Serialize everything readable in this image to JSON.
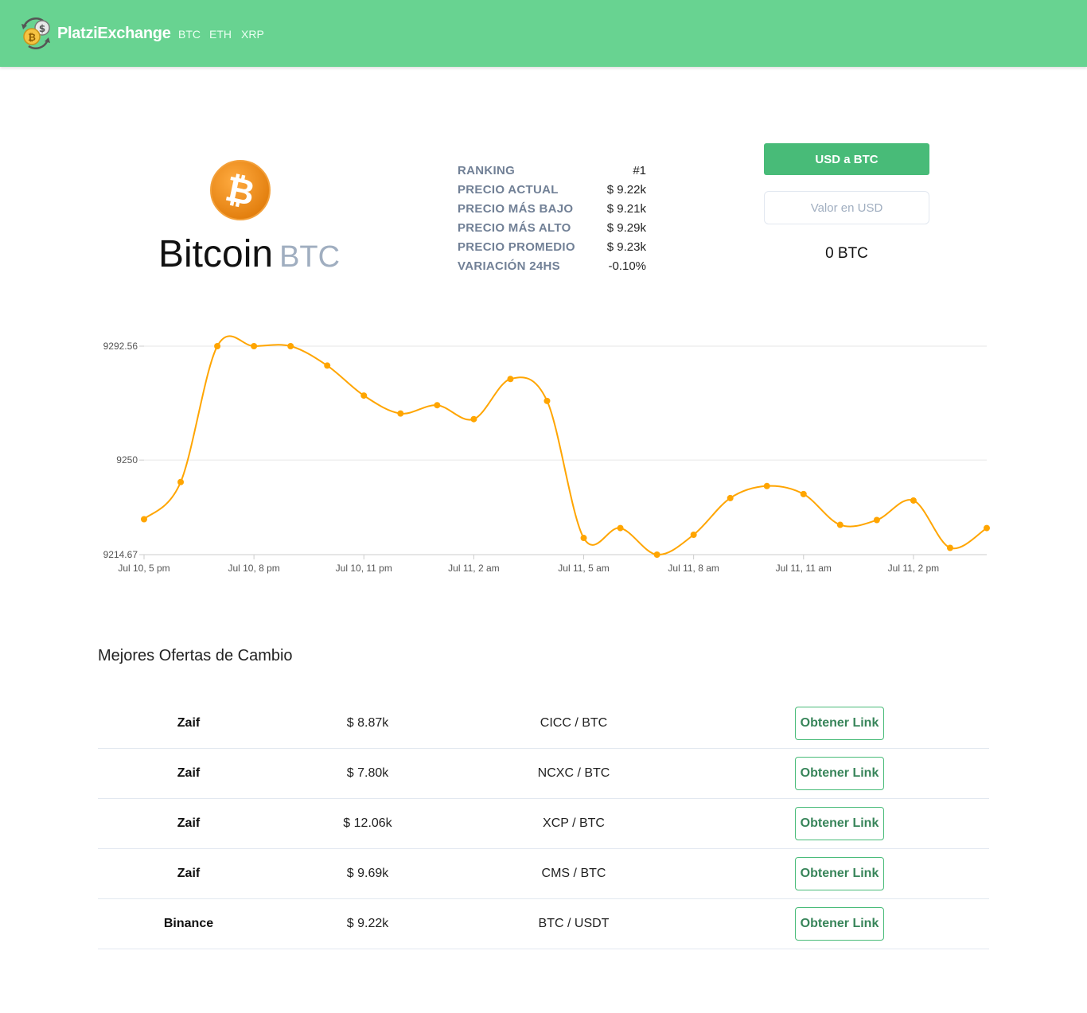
{
  "header": {
    "brand": "PlatziExchange",
    "nav": [
      "BTC",
      "ETH",
      "XRP"
    ],
    "bg_color": "#68d391"
  },
  "coin": {
    "name": "Bitcoin",
    "symbol": "BTC",
    "icon": "bitcoin-icon",
    "icon_color": "#f7931a"
  },
  "stats": [
    {
      "label": "RANKING",
      "value": "#1"
    },
    {
      "label": "PRECIO ACTUAL",
      "value": "$ 9.22k"
    },
    {
      "label": "PRECIO MÁS BAJO",
      "value": "$ 9.21k"
    },
    {
      "label": "PRECIO MÁS ALTO",
      "value": "$ 9.29k"
    },
    {
      "label": "PRECIO PROMEDIO",
      "value": "$ 9.23k"
    },
    {
      "label": "VARIACIÓN 24HS",
      "value": "-0.10%"
    }
  ],
  "converter": {
    "button_label": "USD a BTC",
    "input_placeholder": "Valor en USD",
    "input_value": "",
    "result": "0 BTC",
    "accent": "#48bb78"
  },
  "chart_data": {
    "type": "line",
    "title": "",
    "xlabel": "",
    "ylabel": "",
    "color": "#ffa500",
    "grid": true,
    "legend": "none",
    "ylim": [
      9214.67,
      9292.56
    ],
    "yticks": [
      9214.67,
      9250,
      9292.56
    ],
    "ytick_labels": [
      "9214.67",
      "9250",
      "9292.56"
    ],
    "xlim": [
      0,
      23
    ],
    "xticks": [
      0,
      3,
      6,
      9,
      12,
      15,
      18,
      21
    ],
    "xtick_labels": [
      "Jul 10, 5 pm",
      "Jul 10, 8 pm",
      "Jul 10, 11 pm",
      "Jul 11, 2 am",
      "Jul 11, 5 am",
      "Jul 11, 8 am",
      "Jul 11, 11 am",
      "Jul 11, 2 pm"
    ],
    "series": [
      {
        "name": "",
        "x": [
          0,
          1,
          2,
          3,
          4,
          5,
          6,
          7,
          8,
          9,
          10,
          11,
          12,
          13,
          14,
          15,
          16,
          17,
          18,
          19,
          20,
          21,
          22,
          23
        ],
        "y": [
          9227.9,
          9241.8,
          9292.56,
          9292.56,
          9292.56,
          9285.3,
          9274.1,
          9267.4,
          9270.5,
          9265.3,
          9280.3,
          9272.1,
          9220.9,
          9224.6,
          9214.67,
          9222.1,
          9235.8,
          9240.3,
          9237.3,
          9225.8,
          9227.6,
          9234.9,
          9217.2,
          9224.6
        ]
      }
    ]
  },
  "offers": {
    "title": "Mejores Ofertas de Cambio",
    "rows": [
      {
        "exchange": "Zaif",
        "price": "$ 8.87k",
        "pair": "CICC / BTC",
        "action": "Obtener Link"
      },
      {
        "exchange": "Zaif",
        "price": "$ 7.80k",
        "pair": "NCXC / BTC",
        "action": "Obtener Link"
      },
      {
        "exchange": "Zaif",
        "price": "$ 12.06k",
        "pair": "XCP / BTC",
        "action": "Obtener Link"
      },
      {
        "exchange": "Zaif",
        "price": "$ 9.69k",
        "pair": "CMS / BTC",
        "action": "Obtener Link"
      },
      {
        "exchange": "Binance",
        "price": "$ 9.22k",
        "pair": "BTC / USDT",
        "action": "Obtener Link"
      }
    ]
  }
}
